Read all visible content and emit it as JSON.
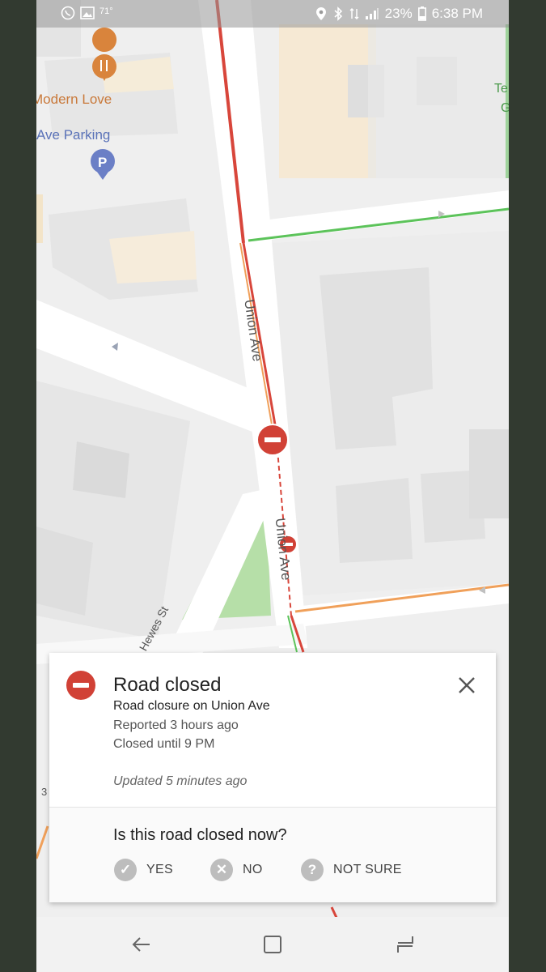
{
  "status_bar": {
    "temperature": "71°",
    "battery": "23%",
    "time": "6:38 PM",
    "icons": [
      "whatsapp-icon",
      "gallery-icon",
      "location-icon",
      "bluetooth-icon",
      "data-icon",
      "signal-icon",
      "battery-icon"
    ]
  },
  "map": {
    "poi": [
      {
        "label": "Modern Love",
        "type": "restaurant",
        "color": "#c9793a"
      },
      {
        "label": "Ave Parking",
        "type": "parking",
        "color": "#5a72b8"
      }
    ],
    "edge_label_top": "Te",
    "edge_label_bottom": "G",
    "streets": {
      "union_ave_north": "Union Ave",
      "union_ave_south": "Union Ave",
      "hewes_st": "Hewes St",
      "partial_left": "3"
    },
    "closure_color": "#d14136",
    "traffic_colors": {
      "heavy": "#d8463b",
      "moderate": "#f0a05a",
      "clear": "#5cc35a"
    }
  },
  "card": {
    "title": "Road closed",
    "subtitle": "Road closure on Union Ave",
    "reported": "Reported 3 hours ago",
    "closed_until": "Closed until 9 PM",
    "updated": "Updated 5 minutes ago",
    "question": "Is this road closed now?",
    "answers": {
      "yes": {
        "label": "YES",
        "icon": "check-circle-icon"
      },
      "no": {
        "label": "NO",
        "icon": "x-circle-icon"
      },
      "not_sure": {
        "label": "NOT SURE",
        "icon": "question-circle-icon"
      }
    }
  },
  "navbar": {
    "buttons": [
      "back-icon",
      "home-icon",
      "recents-icon"
    ]
  }
}
